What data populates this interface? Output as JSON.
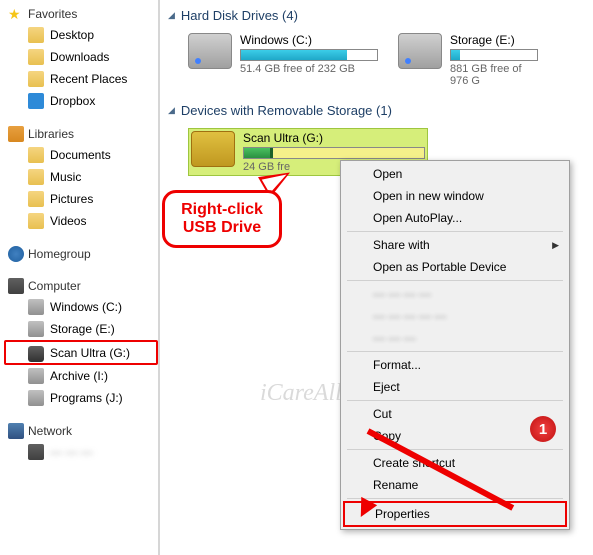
{
  "sidebar": {
    "favorites": {
      "label": "Favorites",
      "items": [
        {
          "label": "Desktop"
        },
        {
          "label": "Downloads"
        },
        {
          "label": "Recent Places"
        },
        {
          "label": "Dropbox"
        }
      ]
    },
    "libraries": {
      "label": "Libraries",
      "items": [
        {
          "label": "Documents"
        },
        {
          "label": "Music"
        },
        {
          "label": "Pictures"
        },
        {
          "label": "Videos"
        }
      ]
    },
    "homegroup": {
      "label": "Homegroup"
    },
    "computer": {
      "label": "Computer",
      "items": [
        {
          "label": "Windows (C:)"
        },
        {
          "label": "Storage (E:)"
        },
        {
          "label": "Scan Ultra (G:)",
          "selected": true
        },
        {
          "label": "Archive (I:)"
        },
        {
          "label": "Programs (J:)"
        }
      ]
    },
    "network": {
      "label": "Network",
      "items": [
        {
          "label": " "
        }
      ]
    }
  },
  "main": {
    "hdd": {
      "header": "Hard Disk Drives (4)",
      "drives": [
        {
          "name": "Windows (C:)",
          "free": "51.4 GB free of 232 GB",
          "fill_pct": 78
        },
        {
          "name": "Storage (E:)",
          "free": "881 GB free of 976 G",
          "fill_pct": 10
        }
      ]
    },
    "removable": {
      "header": "Devices with Removable Storage (1)",
      "drive": {
        "name": "Scan Ultra (G:)",
        "free": "24      GB fre",
        "fill_pct": 16
      }
    }
  },
  "context_menu": {
    "items": [
      {
        "label": "Open"
      },
      {
        "label": "Open in new window"
      },
      {
        "label": "Open AutoPlay..."
      },
      {
        "sep": true
      },
      {
        "label": "Share with",
        "submenu": true
      },
      {
        "label": "Open as Portable Device"
      },
      {
        "sep": true
      },
      {
        "label": "blurred",
        "blurred": true
      },
      {
        "label": "blurred",
        "blurred": true
      },
      {
        "label": "blurred",
        "blurred": true
      },
      {
        "sep": true
      },
      {
        "label": "Format..."
      },
      {
        "label": "Eject"
      },
      {
        "sep": true
      },
      {
        "label": "Cut"
      },
      {
        "label": "Copy"
      },
      {
        "sep": true
      },
      {
        "label": "Create shortcut"
      },
      {
        "label": "Rename"
      },
      {
        "sep": true
      },
      {
        "label": "Properties",
        "highlight": true
      }
    ]
  },
  "callout": {
    "line1": "Right-click",
    "line2": "USB Drive"
  },
  "badge": "1",
  "watermark": "iCareAll.com"
}
